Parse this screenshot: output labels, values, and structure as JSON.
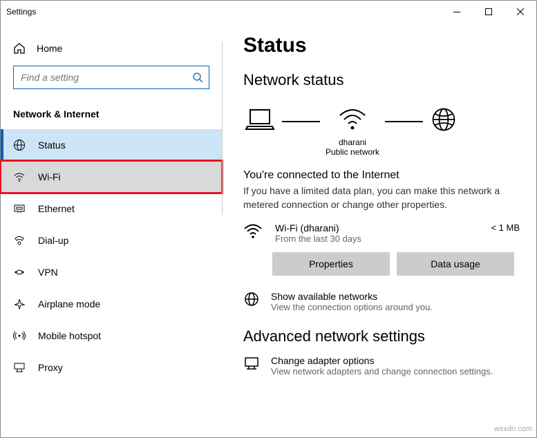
{
  "window": {
    "title": "Settings"
  },
  "sidebar": {
    "home": "Home",
    "search_placeholder": "Find a setting",
    "section": "Network & Internet",
    "items": [
      {
        "label": "Status"
      },
      {
        "label": "Wi-Fi"
      },
      {
        "label": "Ethernet"
      },
      {
        "label": "Dial-up"
      },
      {
        "label": "VPN"
      },
      {
        "label": "Airplane mode"
      },
      {
        "label": "Mobile hotspot"
      },
      {
        "label": "Proxy"
      }
    ]
  },
  "main": {
    "title": "Status",
    "network_status_heading": "Network status",
    "diagram": {
      "wifi_name": "dharani",
      "wifi_type": "Public network"
    },
    "connected_heading": "You're connected to the Internet",
    "connected_desc": "If you have a limited data plan, you can make this network a metered connection or change other properties.",
    "net": {
      "name": "Wi-Fi (dharani)",
      "period": "From the last 30 days",
      "usage": "< 1 MB"
    },
    "buttons": {
      "properties": "Properties",
      "data_usage": "Data usage"
    },
    "show_networks": {
      "title": "Show available networks",
      "desc": "View the connection options around you."
    },
    "advanced_heading": "Advanced network settings",
    "adapter": {
      "title": "Change adapter options",
      "desc": "View network adapters and change connection settings."
    }
  },
  "watermark": "wsxdn.com"
}
